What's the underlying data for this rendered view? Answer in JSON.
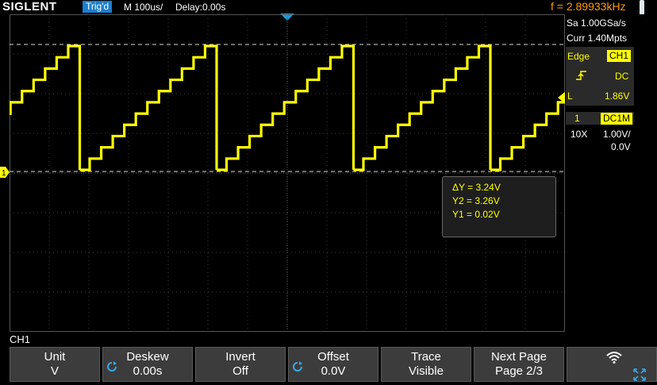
{
  "header": {
    "brand": "SIGLENT",
    "trigger_status": "Trig'd",
    "timebase": "M 100us/",
    "delay": "Delay:0.00s",
    "frequency": "f = 2.89933kHz"
  },
  "acquisition": {
    "sample_rate": "Sa 1.00GSa/s",
    "memory_depth": "Curr 1.40Mpts"
  },
  "trigger": {
    "type": "Edge",
    "source": "CH1",
    "coupling": "DC",
    "level_label": "L",
    "level": "1.86V"
  },
  "channel": {
    "number": "1",
    "coupling": "DC1M",
    "probe": "10X",
    "scale": "1.00V/",
    "offset": "0.0V",
    "name": "CH1"
  },
  "cursor_measurement": {
    "delta_y": "ΔY = 3.24V",
    "y2": "Y2 = 3.26V",
    "y1": "Y1 = 0.02V"
  },
  "softkeys": [
    {
      "title": "Unit",
      "value": "V",
      "knob": false
    },
    {
      "title": "Deskew",
      "value": "0.00s",
      "knob": true
    },
    {
      "title": "Invert",
      "value": "Off",
      "knob": false
    },
    {
      "title": "Offset",
      "value": "0.0V",
      "knob": true
    },
    {
      "title": "Trace",
      "value": "Visible",
      "knob": false
    },
    {
      "title": "Next Page",
      "value": "Page 2/3",
      "knob": false
    }
  ],
  "icons": {
    "wifi": "wifi-icon",
    "fullscreen": "fullscreen-icon"
  },
  "colors": {
    "trace": "#ffff00",
    "frequency": "#ff9a00",
    "trigger_badge": "#1a7fd0"
  }
}
